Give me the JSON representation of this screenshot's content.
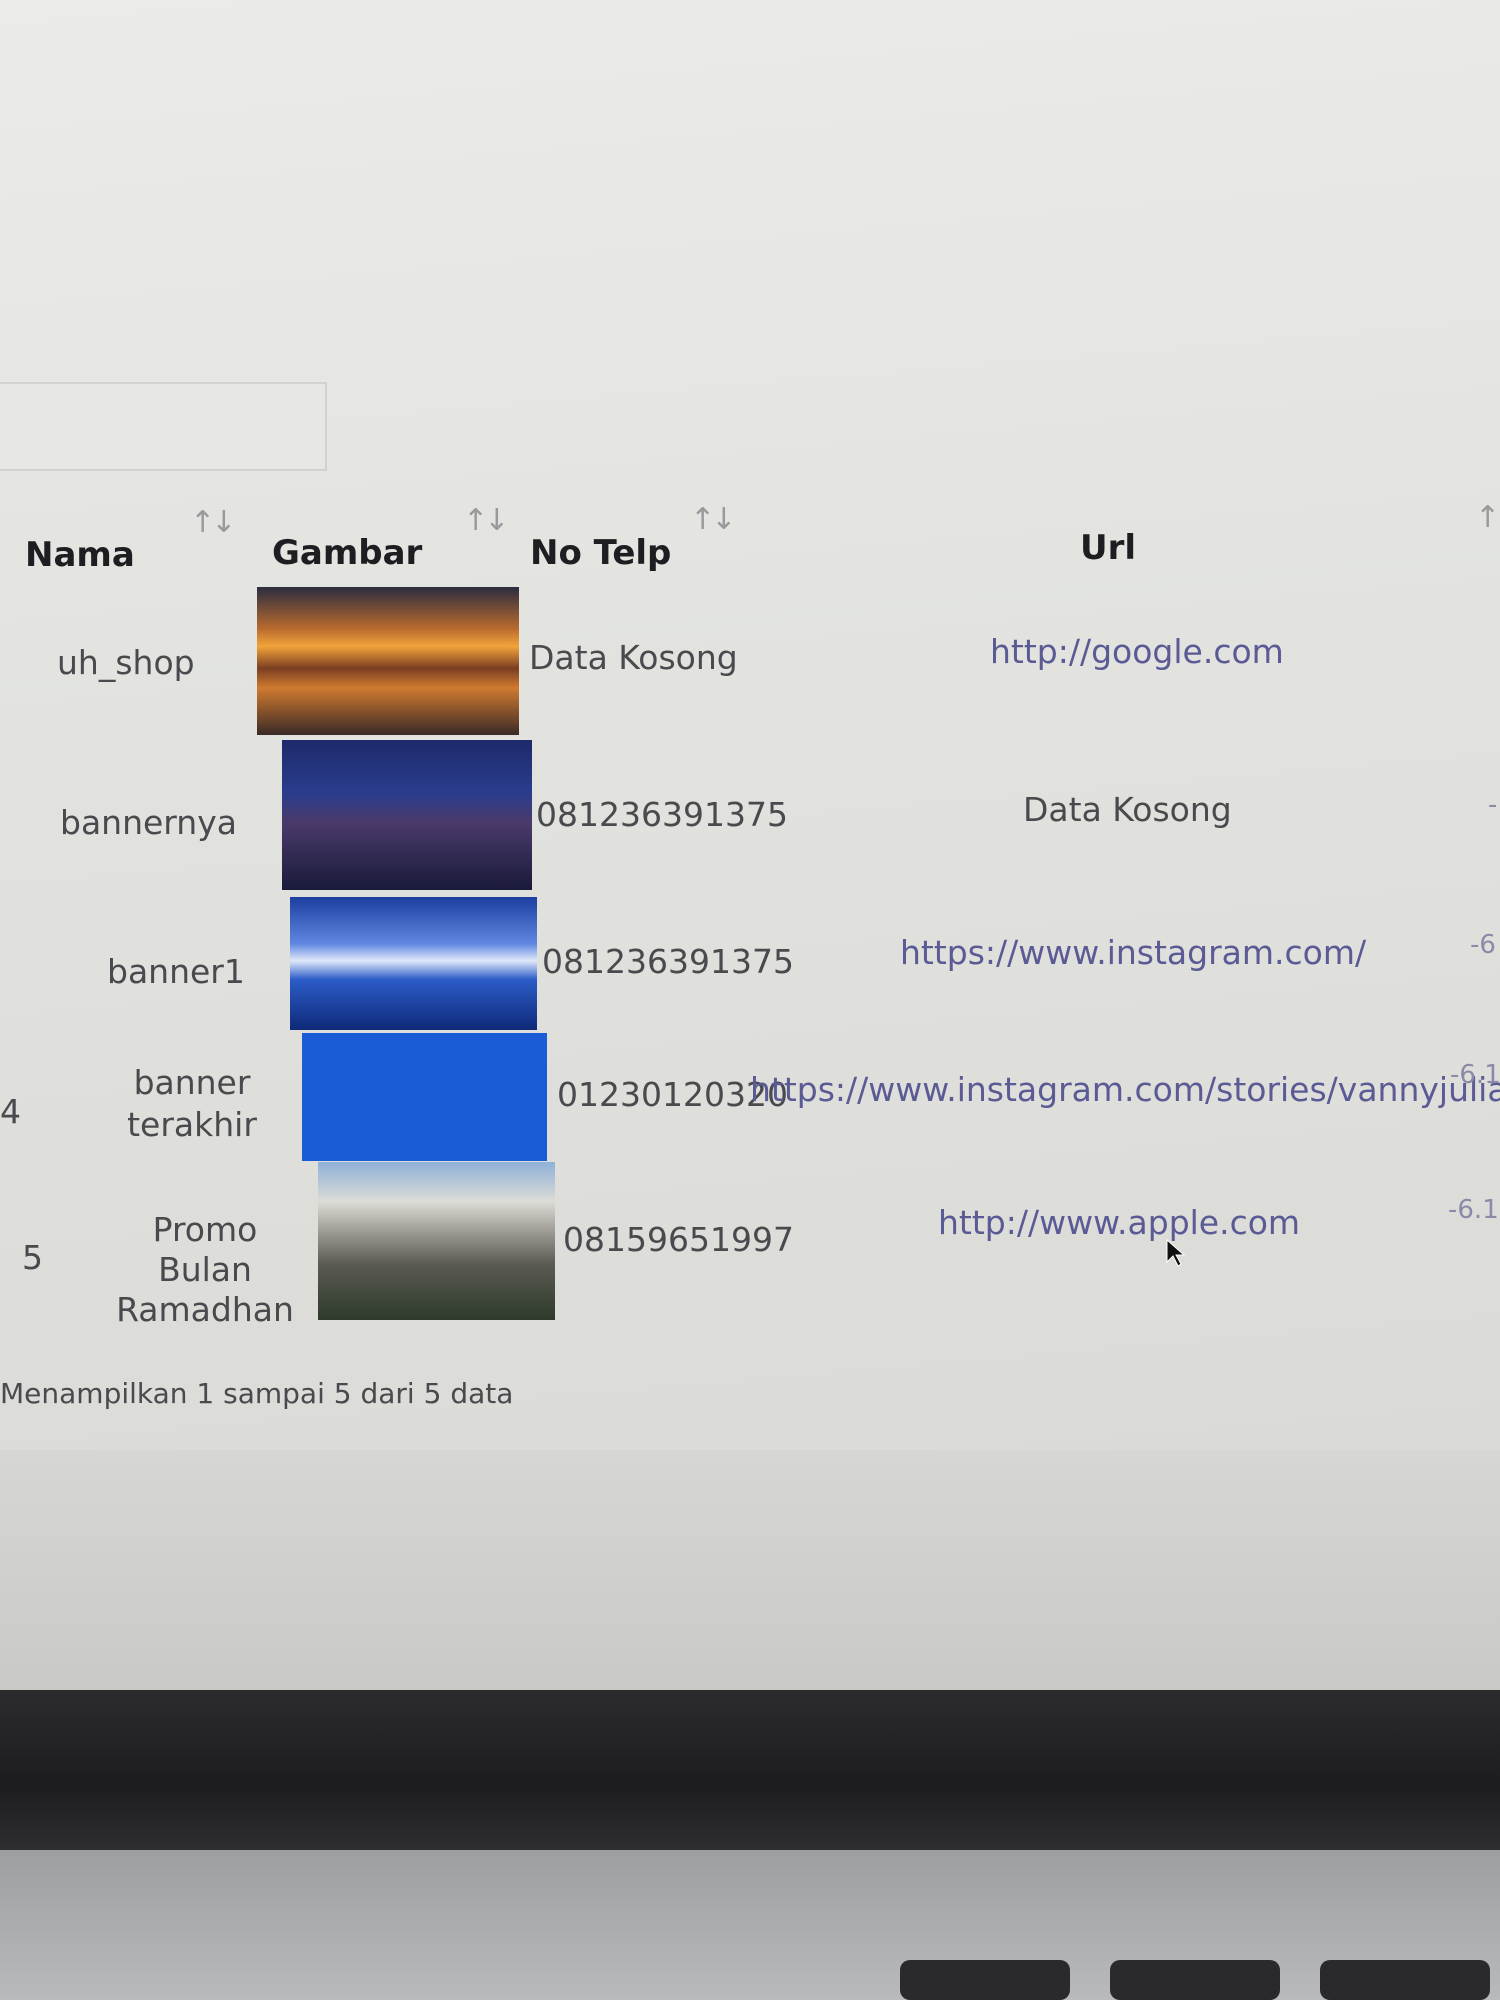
{
  "table": {
    "headers": [
      "Nama",
      "Gambar",
      "No Telp",
      "Url"
    ],
    "sort_icon": "↑↓",
    "rows": [
      {
        "no": "",
        "nama": "uh_shop",
        "telp": "Data Kosong",
        "url": "http://google.com",
        "url_type": "link",
        "extra": ""
      },
      {
        "no": "",
        "nama": "bannernya",
        "telp": "081236391375",
        "url": "Data Kosong",
        "url_type": "text",
        "extra": "-"
      },
      {
        "no": "",
        "nama": "banner1",
        "telp": "081236391375",
        "url": "https://www.instagram.com/",
        "url_type": "link",
        "extra": "-6"
      },
      {
        "no": "4",
        "nama": "banner terakhir",
        "telp": "01230120320",
        "url": "https://www.instagram.com/stories/vannyjulian/",
        "url_type": "link",
        "extra": "-6.1"
      },
      {
        "no": "5",
        "nama": "Promo Bulan Ramadhan",
        "telp": "08159651997",
        "url": "http://www.apple.com",
        "url_type": "link",
        "extra": "-6.1"
      }
    ]
  },
  "footer": {
    "info": "Menampilkan 1 sampai 5 dari 5 data"
  },
  "colors": {
    "link": "#5a5a95",
    "text": "#4a4a4e",
    "header": "#1e1e22"
  }
}
